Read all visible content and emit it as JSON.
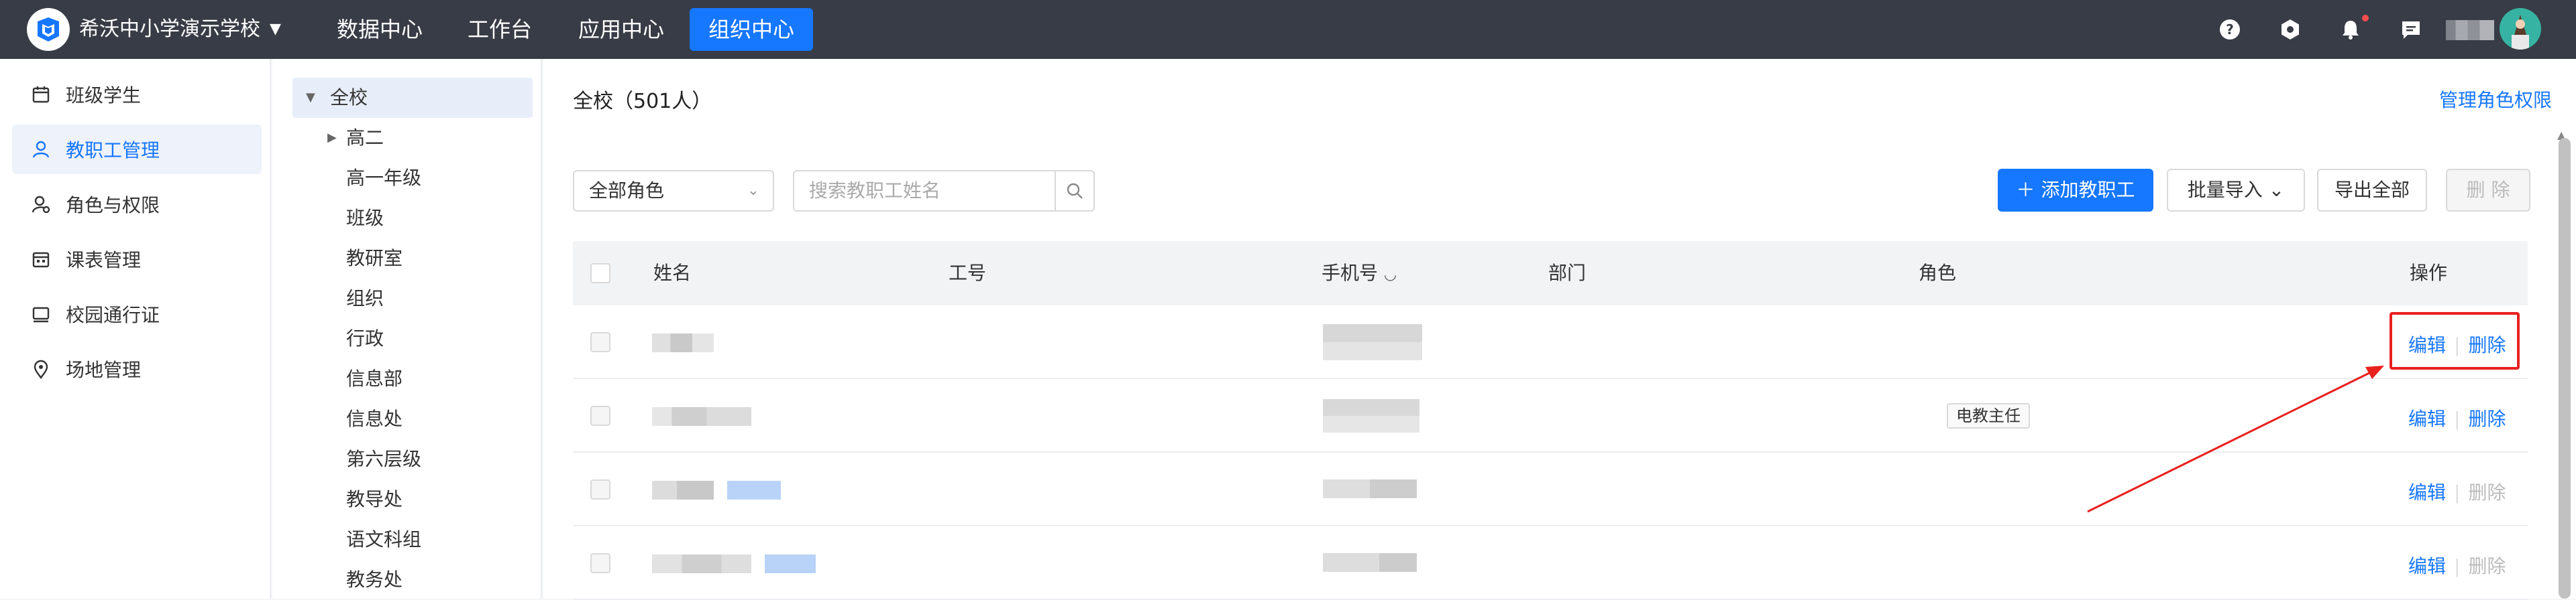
{
  "topbar": {
    "school_name": "希沃中小学演示学校",
    "nav": [
      "数据中心",
      "工作台",
      "应用中心",
      "组织中心"
    ],
    "active_nav": "组织中心"
  },
  "sidebar": {
    "items": [
      {
        "label": "班级学生",
        "icon": "calendar-icon"
      },
      {
        "label": "教职工管理",
        "icon": "person-icon"
      },
      {
        "label": "角色与权限",
        "icon": "user-permission-icon"
      },
      {
        "label": "课表管理",
        "icon": "schedule-icon"
      },
      {
        "label": "校园通行证",
        "icon": "card-icon"
      },
      {
        "label": "场地管理",
        "icon": "location-pin-icon"
      }
    ],
    "active": "教职工管理"
  },
  "tree": {
    "root": "全校",
    "children": [
      "高二",
      "高一年级",
      "班级",
      "教研室",
      "组织",
      "行政",
      "信息部",
      "信息处",
      "第六层级",
      "教导处",
      "语文科组",
      "教务处"
    ]
  },
  "main": {
    "title": "全校（501人）",
    "manage_link": "管理角色权限",
    "role_select": "全部角色",
    "search_placeholder": "搜索教职工姓名",
    "add_button": "添加教职工",
    "import_button": "批量导入",
    "export_button": "导出全部",
    "delete_button": "删 除",
    "columns": [
      "姓名",
      "工号",
      "手机号",
      "部门",
      "角色",
      "操作"
    ],
    "rows": [
      {
        "role": "",
        "edit": "编辑",
        "delete": "删除",
        "delete_enabled": true
      },
      {
        "role": "电教主任",
        "edit": "编辑",
        "delete": "删除",
        "delete_enabled": true
      },
      {
        "role": "",
        "edit": "编辑",
        "delete": "删除",
        "delete_enabled": false
      },
      {
        "role": "",
        "edit": "编辑",
        "delete": "删除",
        "delete_enabled": false
      }
    ]
  },
  "colors": {
    "topbar": "#383c46",
    "accent": "#1677ff",
    "annotation_red": "#e8201e"
  }
}
